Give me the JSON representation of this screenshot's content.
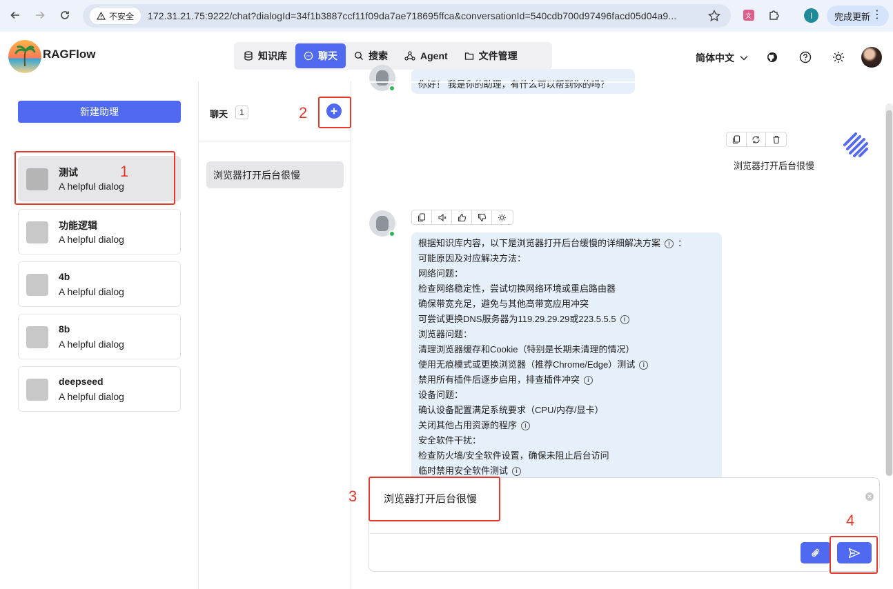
{
  "browser": {
    "security_label": "不安全",
    "url": "172.31.21.75:9222/chat?dialogId=34f1b3887ccf11f09da7ae718695ffca&conversationId=540cdb700d97496facd05d04a9...",
    "profile_initial": "I",
    "update_label": "完成更新"
  },
  "app": {
    "brand": "RAGFlow",
    "nav": [
      {
        "label": "知识库",
        "icon": "database-icon"
      },
      {
        "label": "聊天",
        "icon": "chat-icon"
      },
      {
        "label": "搜索",
        "icon": "search-icon"
      },
      {
        "label": "Agent",
        "icon": "agent-icon"
      },
      {
        "label": "文件管理",
        "icon": "folder-icon"
      }
    ],
    "active_nav": "聊天",
    "language": "简体中文"
  },
  "assistants": {
    "new_button": "新建助理",
    "items": [
      {
        "name": "测试",
        "desc": "A helpful dialog",
        "selected": true
      },
      {
        "name": "功能逻辑",
        "desc": "A helpful dialog"
      },
      {
        "name": "4b",
        "desc": "A helpful dialog"
      },
      {
        "name": "8b",
        "desc": "A helpful dialog"
      },
      {
        "name": "deepseed",
        "desc": "A helpful dialog"
      }
    ]
  },
  "conversations": {
    "title": "聊天",
    "count": "1",
    "items": [
      {
        "label": "浏览器打开后台很慢"
      }
    ]
  },
  "chat": {
    "greeting": "你好！ 我是你的助理，有什么可以帮到你的吗？",
    "user_message": "浏览器打开后台很慢",
    "answer_lines": [
      {
        "text": "根据知识库内容，以下是浏览器打开后台缓慢的详细解决方案",
        "cite": true,
        "suffix": "："
      },
      {
        "text": "可能原因及对应解决方法："
      },
      {
        "text": "网络问题："
      },
      {
        "text": "检查网络稳定性，尝试切换网络环境或重启路由器"
      },
      {
        "text": "确保带宽充足，避免与其他高带宽应用冲突"
      },
      {
        "text": "可尝试更换DNS服务器为119.29.29.29或223.5.5.5",
        "cite": true
      },
      {
        "text": "浏览器问题："
      },
      {
        "text": "清理浏览器缓存和Cookie（特别是长期未清理的情况）"
      },
      {
        "text": "使用无痕模式或更换浏览器（推荐Chrome/Edge）测试",
        "cite": true
      },
      {
        "text": "禁用所有插件后逐步启用，排查插件冲突",
        "cite": true
      },
      {
        "text": "设备问题："
      },
      {
        "text": "确认设备配置满足系统要求（CPU/内存/显卡）"
      },
      {
        "text": "关闭其他占用资源的程序",
        "cite": true
      },
      {
        "text": "安全软件干扰："
      },
      {
        "text": "检查防火墙/安全软件设置，确保未阻止后台访问"
      },
      {
        "text": "临时禁用安全软件测试",
        "cite": true
      }
    ],
    "input_value": "浏览器打开后台很慢"
  },
  "annotations": [
    "1",
    "2",
    "3",
    "4"
  ],
  "colors": {
    "accent": "#4f6af0",
    "annotation": "#e5382a",
    "bubble": "#e6f0fb",
    "online": "#2fb45a"
  }
}
